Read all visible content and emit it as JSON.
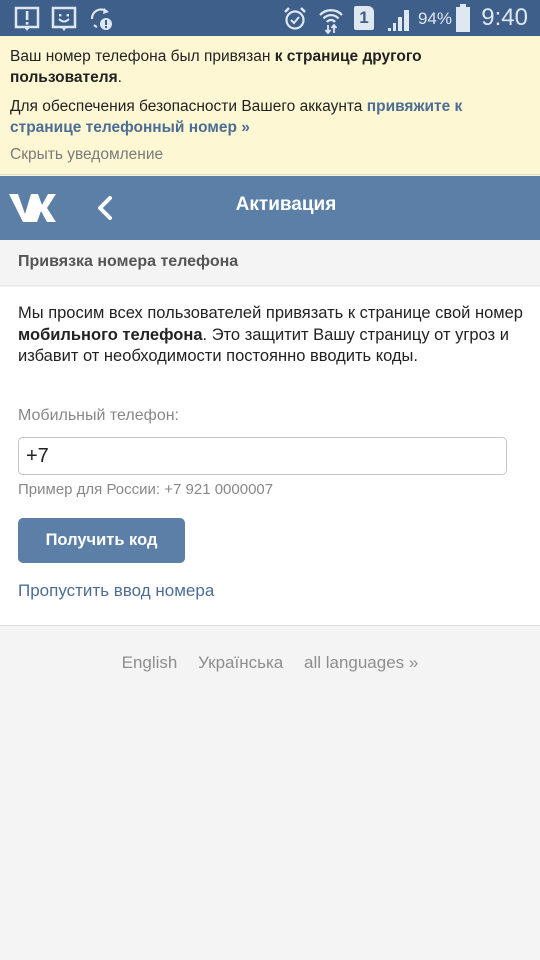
{
  "status_bar": {
    "left_icons": [
      "alert-notification-icon",
      "feedback-notification-icon",
      "sync-error-icon"
    ],
    "right_icons": [
      "alarm-icon",
      "wifi-icon",
      "sim-1-icon",
      "signal-icon",
      "battery-icon"
    ],
    "sim_label": "1",
    "battery": "94%",
    "time": "9:40",
    "background": "#3e5f8a"
  },
  "notice": {
    "line1_text": "Ваш номер телефона был привязан ",
    "line1_bold": "к странице другого пользователя",
    "line1_end": ".",
    "line2_text": "Для обеспечения безопасности Вашего аккаунта ",
    "line2_link": "привяжите к странице телефонный номер »",
    "hide_label": "Скрыть уведомление",
    "background": "#fdf8d3"
  },
  "header": {
    "logo": "vk-logo",
    "title": "Активация",
    "background": "#5b7fa6"
  },
  "section": {
    "title": "Привязка номера телефона"
  },
  "form": {
    "intro_text": "Мы просим всех пользователей привязать к странице свой номер ",
    "intro_bold": "мобильного телефона",
    "intro_end": ". Это защитит Вашу страницу от угроз и избавит от необходимости постоянно вводить коды.",
    "phone_label": "Мобильный телефон:",
    "phone_value": "+7",
    "hint": "Пример для России: +7 921 0000007",
    "submit_label": "Получить код",
    "skip_label": "Пропустить ввод номера",
    "accent": "#5b7fa6"
  },
  "footer": {
    "languages": [
      "English",
      "Українська",
      "all languages »"
    ]
  }
}
